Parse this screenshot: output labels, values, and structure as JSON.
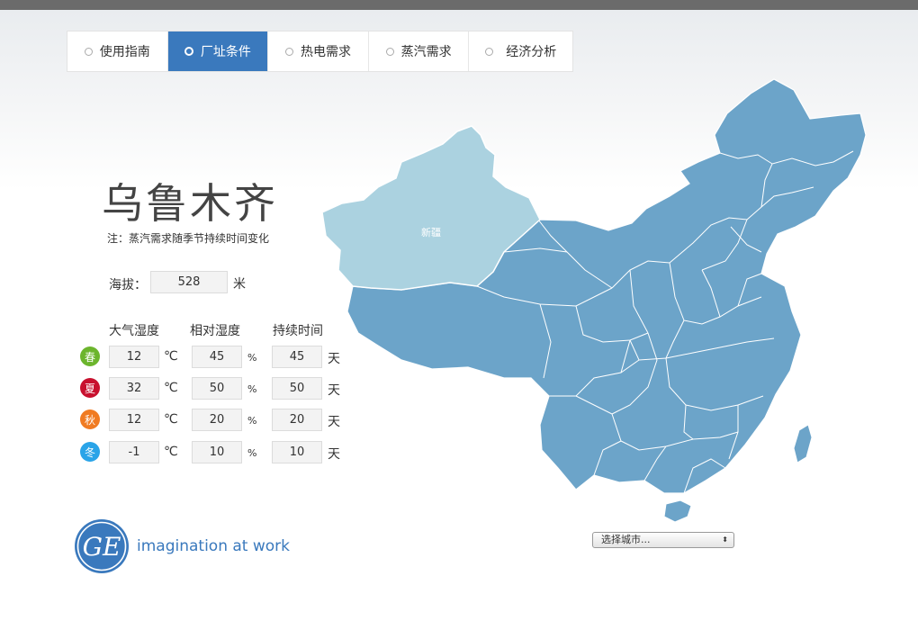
{
  "nav": {
    "tabs": [
      {
        "label": "使用指南"
      },
      {
        "label": "厂址条件"
      },
      {
        "label": "热电需求"
      },
      {
        "label": "蒸汽需求"
      },
      {
        "label": "经济分析"
      }
    ],
    "active_index": 1
  },
  "city": {
    "name": "乌鲁木齐",
    "note": "注：蒸汽需求随季节持续时间变化"
  },
  "altitude": {
    "label": "海拔：",
    "value": "528",
    "unit": "米"
  },
  "climate": {
    "headers": [
      "大气湿度",
      "相对湿度",
      "持续时间"
    ],
    "units": {
      "temp": "℃",
      "humidity": "%",
      "duration": "天"
    },
    "seasons": [
      {
        "name": "春",
        "color": "#6cb52d",
        "temp": "12",
        "humidity": "45",
        "duration": "45"
      },
      {
        "name": "夏",
        "color": "#c8102e",
        "temp": "32",
        "humidity": "50",
        "duration": "50"
      },
      {
        "name": "秋",
        "color": "#f07b22",
        "temp": "12",
        "humidity": "20",
        "duration": "20"
      },
      {
        "name": "冬",
        "color": "#2aa4e8",
        "temp": "-1",
        "humidity": "10",
        "duration": "10"
      }
    ]
  },
  "map": {
    "highlighted_region": "新疆",
    "highlight_color": "#abd2e0",
    "province_color": "#6ca4c9"
  },
  "city_select": {
    "placeholder": "选择城市..."
  },
  "brand": {
    "logo_text": "GE",
    "tagline": "imagination at work",
    "color": "#3a79bd"
  }
}
